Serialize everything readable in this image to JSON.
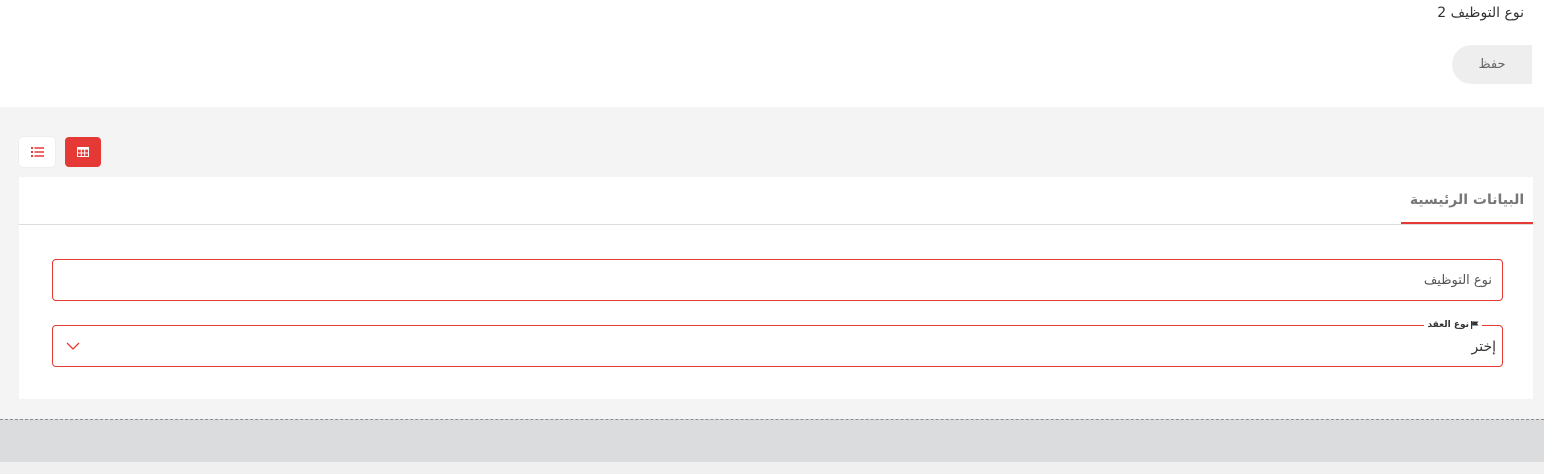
{
  "header": {
    "title": "نوع التوظيف 2",
    "save_label": "حفظ"
  },
  "toolbar": {
    "view_options": [
      {
        "icon": "list-icon",
        "active": false
      },
      {
        "icon": "grid-table-icon",
        "active": true
      }
    ]
  },
  "tabs": [
    {
      "label": "البيانات الرئيسية",
      "active": true
    }
  ],
  "form": {
    "employment_type": {
      "value": "",
      "placeholder": "نوع التوظيف"
    },
    "contract_type": {
      "label": "نوع العقد",
      "label_icon": "flag-icon",
      "selected": "إختر"
    }
  },
  "colors": {
    "accent": "#e53935",
    "work_area_bg": "#f4f4f4",
    "bottom_bar_bg": "#dadcde"
  }
}
